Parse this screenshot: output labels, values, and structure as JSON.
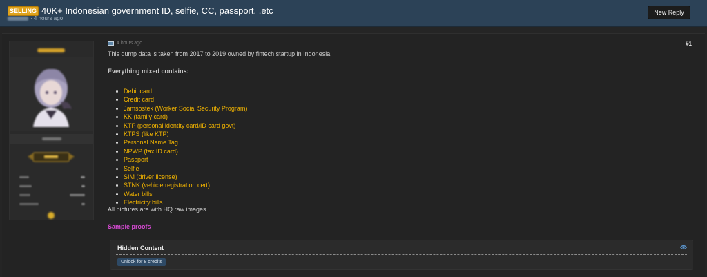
{
  "thread": {
    "prefix": "SELLING",
    "title": "40K+ Indonesian government ID, selfie, CC, passport, .etc",
    "time_ago": "· 4 hours ago",
    "new_reply_label": "New Reply"
  },
  "post": {
    "time_ago": "4 hours ago",
    "number": "#1",
    "intro": "This dump data is taken from 2017 to 2019 owned by fintech startup in Indonesia.",
    "list_heading": "Everything mixed contains:",
    "items": [
      "Debit card",
      "Credit card",
      "Jamsostek (Worker Social Security Program)",
      "KK (family card)",
      "KTP (personal identity card/ID card govt)",
      "KTPS (like KTP)",
      "Personal Name Tag",
      "NPWP (tax ID card)",
      "Passport",
      "Selfie",
      "SIM (driver license)",
      "STNK (vehicle registration cert)",
      "Water bills",
      "Electricity bills"
    ],
    "footer_text": "All pictures are with HQ raw images.",
    "sample_link": "Sample proofs"
  },
  "hidden_content": {
    "title": "Hidden Content",
    "unlock_label": "Unlock for 8 credits"
  },
  "icons": {
    "flag": "flag-icon",
    "eye": "eye-icon",
    "award": "award-icon"
  },
  "colors": {
    "header_bg": "#2c4257",
    "prefix_bg": "#e0a31c",
    "list_item": "#f1b300",
    "sample_link": "#d64ad3",
    "unlock_bg": "#2e4a66"
  }
}
